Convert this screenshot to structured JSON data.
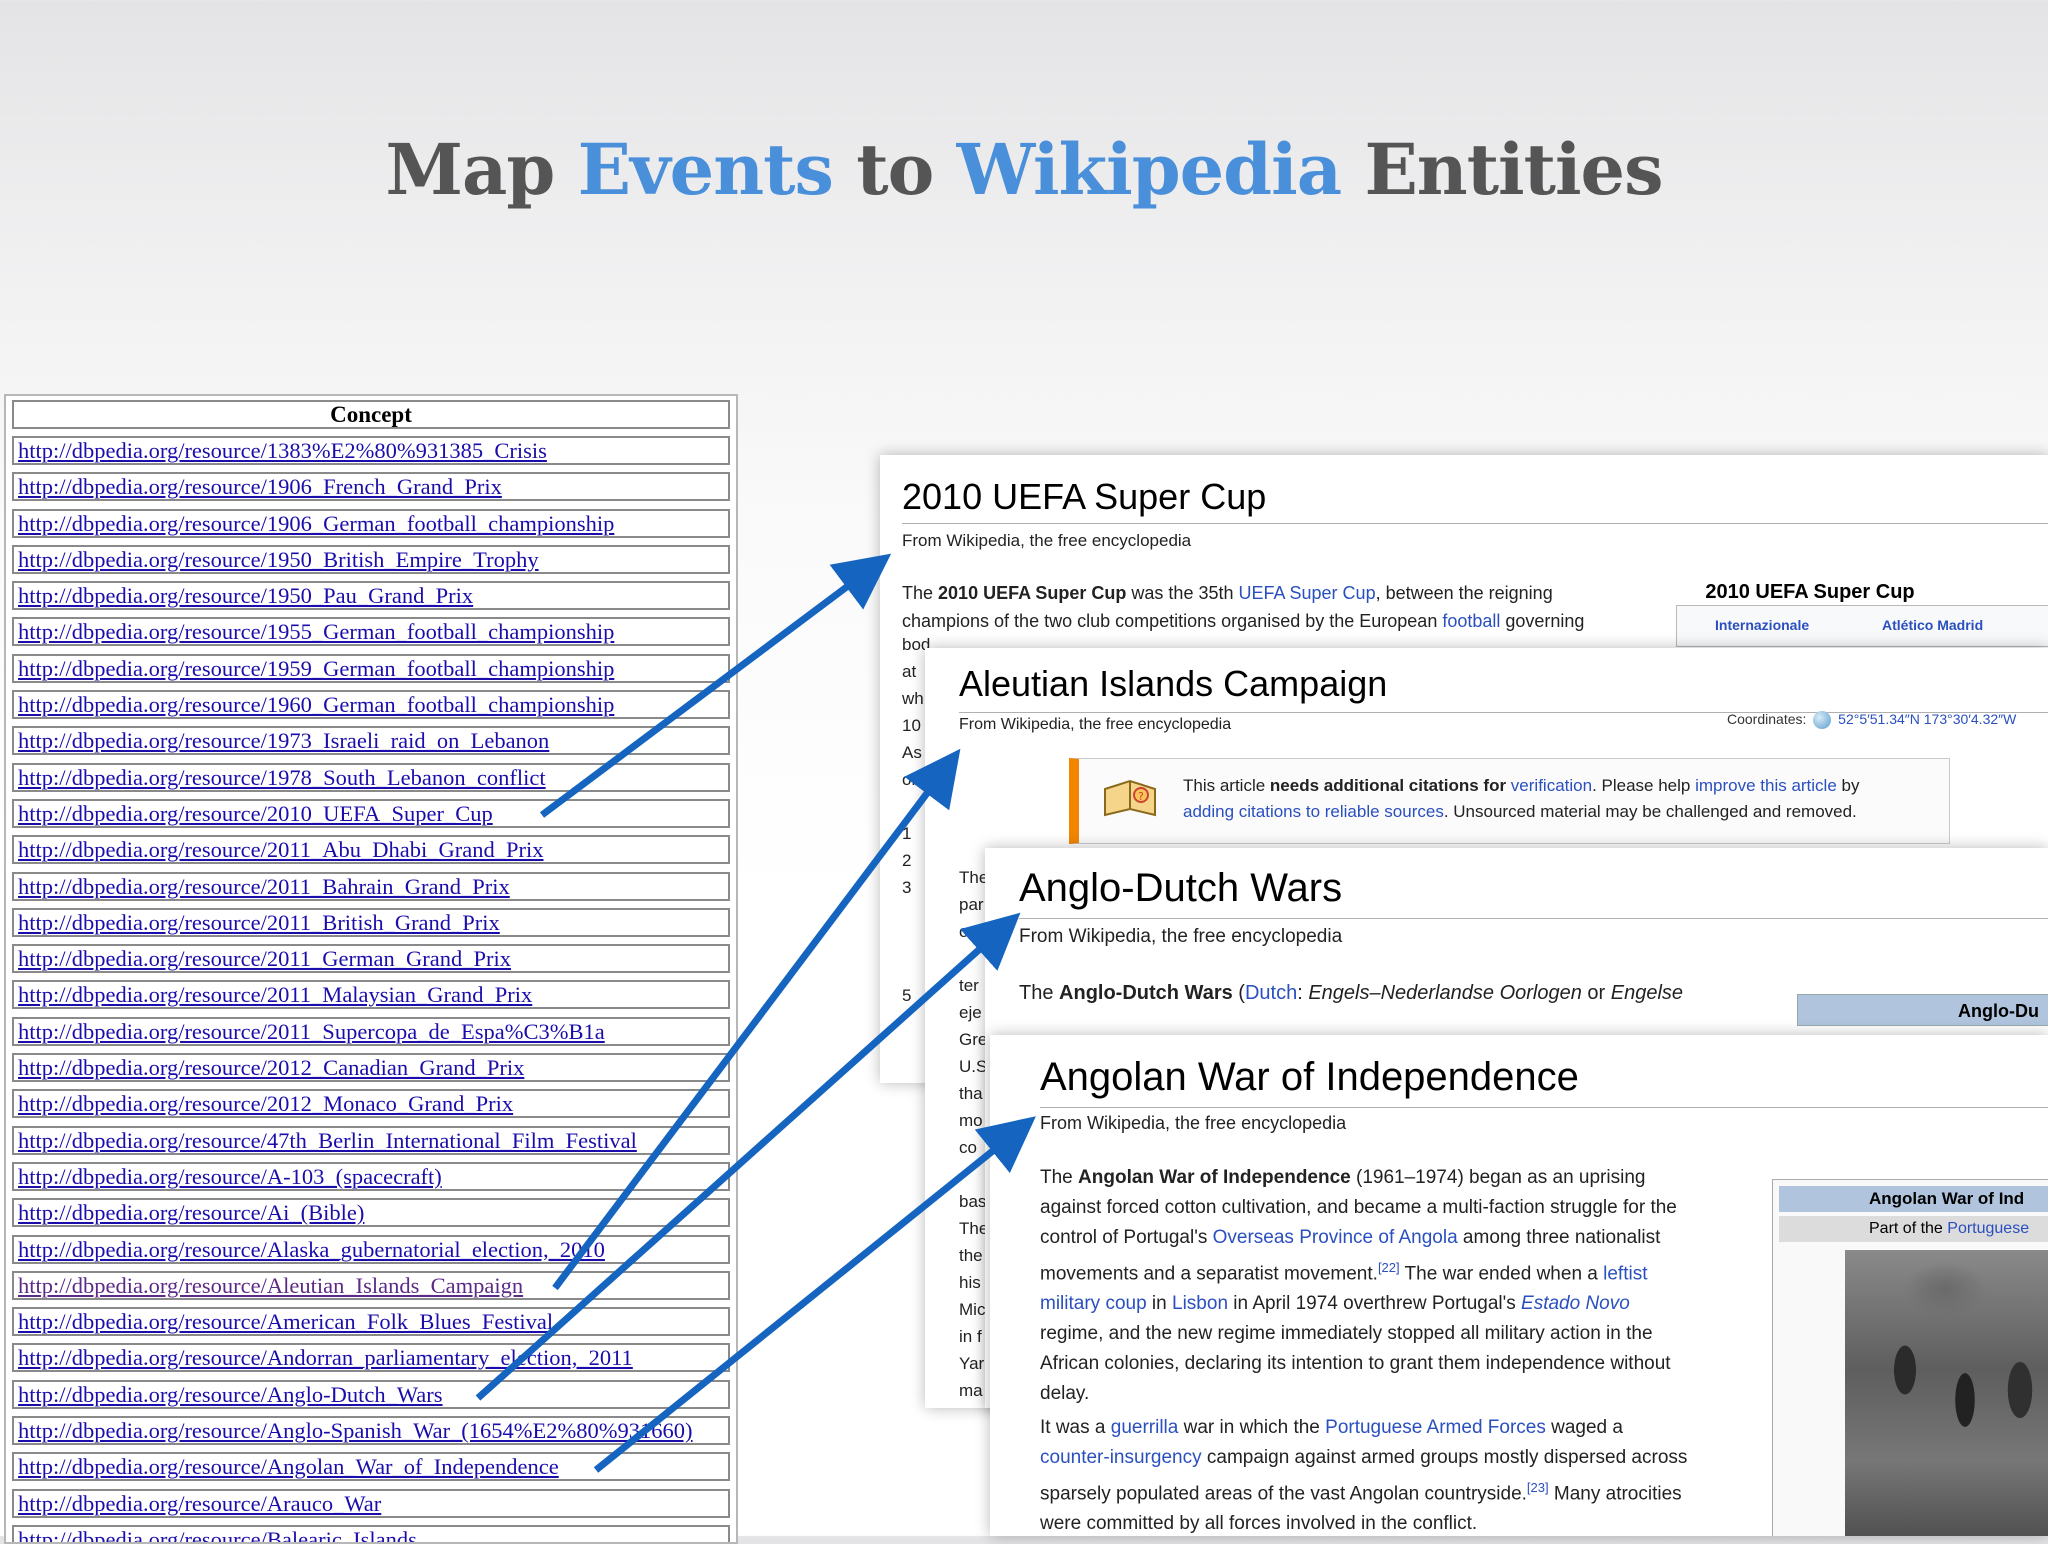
{
  "title": {
    "part1": "Map ",
    "part2": "Events",
    "part3": " to ",
    "part4": "Wikipedia",
    "part5": " Entities"
  },
  "concept_table": {
    "header": "Concept",
    "rows": [
      "http://dbpedia.org/resource/1383%E2%80%931385_Crisis",
      "http://dbpedia.org/resource/1906_French_Grand_Prix",
      "http://dbpedia.org/resource/1906_German_football_championship",
      "http://dbpedia.org/resource/1950_British_Empire_Trophy",
      "http://dbpedia.org/resource/1950_Pau_Grand_Prix",
      "http://dbpedia.org/resource/1955_German_football_championship",
      "http://dbpedia.org/resource/1959_German_football_championship",
      "http://dbpedia.org/resource/1960_German_football_championship",
      "http://dbpedia.org/resource/1973_Israeli_raid_on_Lebanon",
      "http://dbpedia.org/resource/1978_South_Lebanon_conflict",
      "http://dbpedia.org/resource/2010_UEFA_Super_Cup",
      "http://dbpedia.org/resource/2011_Abu_Dhabi_Grand_Prix",
      "http://dbpedia.org/resource/2011_Bahrain_Grand_Prix",
      "http://dbpedia.org/resource/2011_British_Grand_Prix",
      "http://dbpedia.org/resource/2011_German_Grand_Prix",
      "http://dbpedia.org/resource/2011_Malaysian_Grand_Prix",
      "http://dbpedia.org/resource/2011_Supercopa_de_Espa%C3%B1a",
      "http://dbpedia.org/resource/2012_Canadian_Grand_Prix",
      "http://dbpedia.org/resource/2012_Monaco_Grand_Prix",
      "http://dbpedia.org/resource/47th_Berlin_International_Film_Festival",
      "http://dbpedia.org/resource/A-103_(spacecraft)",
      "http://dbpedia.org/resource/Ai_(Bible)",
      "http://dbpedia.org/resource/Alaska_gubernatorial_election,_2010",
      "http://dbpedia.org/resource/Aleutian_Islands_Campaign",
      "http://dbpedia.org/resource/American_Folk_Blues_Festival",
      "http://dbpedia.org/resource/Andorran_parliamentary_election,_2011",
      "http://dbpedia.org/resource/Anglo-Dutch_Wars",
      "http://dbpedia.org/resource/Anglo-Spanish_War_(1654%E2%80%931660)",
      "http://dbpedia.org/resource/Angolan_War_of_Independence",
      "http://dbpedia.org/resource/Arauco_War",
      "http://dbpedia.org/resource/Balearic_Islands"
    ]
  },
  "cards": {
    "uefa": {
      "title": "2010 UEFA Super Cup",
      "subtitle": "From Wikipedia, the free encyclopedia",
      "body_1a": "The ",
      "body_1b": "2010 UEFA Super Cup",
      "body_1c": " was the 35th ",
      "body_1d": "UEFA Super Cup",
      "body_1e": ", between the reigning",
      "body_2a": "champions of the two club competitions organised by the European ",
      "body_2b": "football",
      "body_2c": " governing",
      "infobox_title": "2010 UEFA Super Cup",
      "infobox_team1": "Internazionale",
      "infobox_team2": "Atlético Madrid",
      "edge_lines": [
        "bod",
        "at",
        "wh",
        "10",
        "As",
        "on",
        "",
        "1",
        "2",
        "3",
        "",
        "",
        "",
        "5"
      ]
    },
    "aleutian": {
      "title": "Aleutian Islands Campaign",
      "subtitle": "From Wikipedia, the free encyclopedia",
      "coordinates_label": "Coordinates:",
      "coordinates_value": "52°5′51.34″N 173°30′4.32″W",
      "notice_1a": "This article ",
      "notice_1b": "needs additional citations for ",
      "notice_1c": "verification",
      "notice_1d": ". Please help ",
      "notice_1e": "improve this article",
      "notice_1f": " by",
      "notice_2a": "adding citations to reliable sources",
      "notice_2b": ". Unsourced material may be challenged and removed.",
      "edge_lines": [
        "The",
        "par",
        "on",
        "",
        "ter",
        "eje",
        "Gre",
        "U.S",
        "tha",
        "mo",
        "co",
        "",
        "bas",
        "The",
        "the",
        "his",
        "Mic",
        "in f",
        "Yar",
        "ma"
      ]
    },
    "anglo": {
      "title": "Anglo-Dutch Wars",
      "subtitle": "From Wikipedia, the free encyclopedia",
      "body_a": "The ",
      "body_b": "Anglo-Dutch Wars",
      "body_c": " (",
      "body_d": "Dutch",
      "body_e": ": ",
      "body_f": "Engels–Nederlandse Oorlogen",
      "body_g": " or ",
      "body_h": "Engelse",
      "infobox_title": "Anglo-Du"
    },
    "angolan": {
      "title": "Angolan War of Independence",
      "subtitle": "From Wikipedia, the free encyclopedia",
      "p1": [
        [
          "The ",
          "",
          "Angolan War of Independence",
          "b",
          " (1961–1974) began as an uprising",
          ""
        ],
        [
          "against forced cotton cultivation, and became a multi-faction struggle for the",
          ""
        ],
        [
          "control of Portugal's ",
          "",
          "Overseas Province of Angola",
          "l",
          " among three nationalist",
          ""
        ],
        [
          "movements and a separatist movement.",
          "",
          "[22]",
          "s",
          " The war ended when a ",
          "",
          "leftist",
          "l"
        ],
        [
          "military coup",
          "l",
          " in ",
          "",
          "Lisbon",
          "l",
          " in April 1974 overthrew Portugal's ",
          "",
          "Estado Novo",
          "li"
        ],
        [
          "regime, and the new regime immediately stopped all military action in the",
          ""
        ],
        [
          "African colonies, declaring its intention to grant them independence without",
          ""
        ],
        [
          "delay.",
          ""
        ]
      ],
      "p2": [
        [
          "It was a ",
          "",
          "guerrilla",
          "l",
          " war in which the ",
          "",
          "Portuguese Armed Forces",
          "l",
          " waged a",
          ""
        ],
        [
          "counter-insurgency",
          "l",
          " campaign against armed groups mostly dispersed across",
          ""
        ],
        [
          "sparsely populated areas of the vast Angolan countryside.",
          "",
          "[23]",
          "s",
          " Many atrocities",
          ""
        ],
        [
          "were committed by all forces involved in the conflict.",
          ""
        ]
      ],
      "infobox_title": "Angolan War of Ind",
      "infobox_part_a": "Part of the ",
      "infobox_part_b": "Portuguese"
    }
  },
  "colors": {
    "title_gray": "#555555",
    "title_accent": "#4a8fd9",
    "arrow": "#1565c0",
    "link": "#1a0dab"
  }
}
